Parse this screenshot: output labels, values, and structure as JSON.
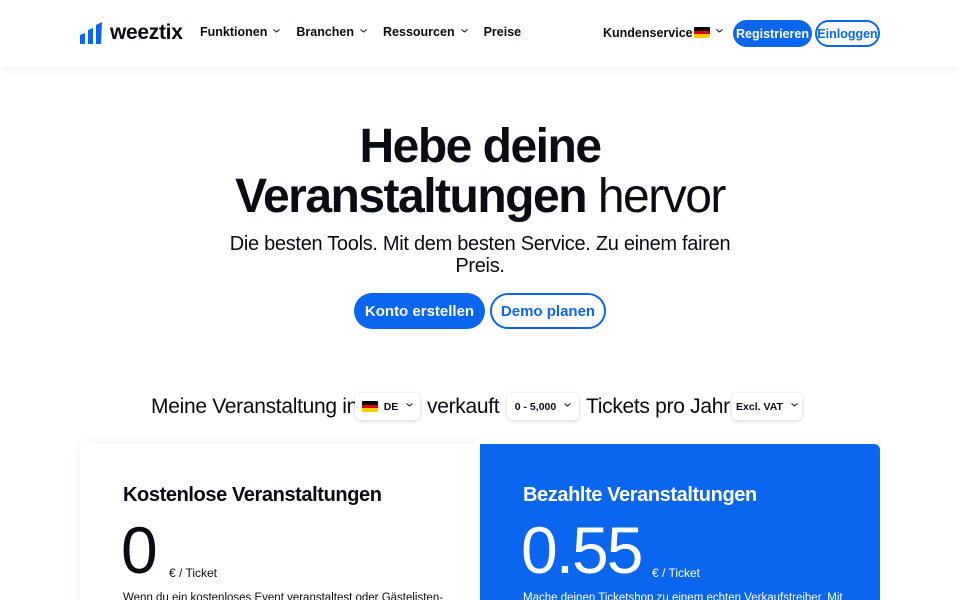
{
  "brand": {
    "name": "weeztix",
    "accent": "#0a66ee"
  },
  "nav": {
    "items": [
      {
        "label": "Funktionen",
        "dropdown": true
      },
      {
        "label": "Branchen",
        "dropdown": true
      },
      {
        "label": "Ressourcen",
        "dropdown": true
      },
      {
        "label": "Preise",
        "dropdown": false
      }
    ],
    "support": "Kundenservice",
    "language_icon": "flag-de-icon",
    "register": "Registrieren",
    "login": "Einloggen"
  },
  "hero": {
    "line1": "Hebe deine",
    "line2_bold": "Veranstaltungen",
    "line2_light": "hervor",
    "subtitle": "Die besten Tools. Mit dem besten Service. Zu einem fairen Preis.",
    "primary_cta": "Konto erstellen",
    "secondary_cta": "Demo planen"
  },
  "config": {
    "text1": "Meine Veranstaltung in",
    "country": "DE",
    "text2": "verkauft",
    "tickets_range": "0 - 5,000",
    "text3": "Tickets pro Jahr",
    "vat": "Excl. VAT"
  },
  "pricing": {
    "free": {
      "title": "Kostenlose Veranstaltungen",
      "price": "0",
      "unit": "€ / Ticket",
      "desc": "Wenn du ein kostenloses Event veranstaltest oder Gästelisten-"
    },
    "paid": {
      "title": "Bezahlte Veranstaltungen",
      "price": "0.55",
      "unit": "€ / Ticket",
      "desc": "Mache deinen Ticketshop zu einem echten Verkaufstreiber. Mit"
    }
  }
}
